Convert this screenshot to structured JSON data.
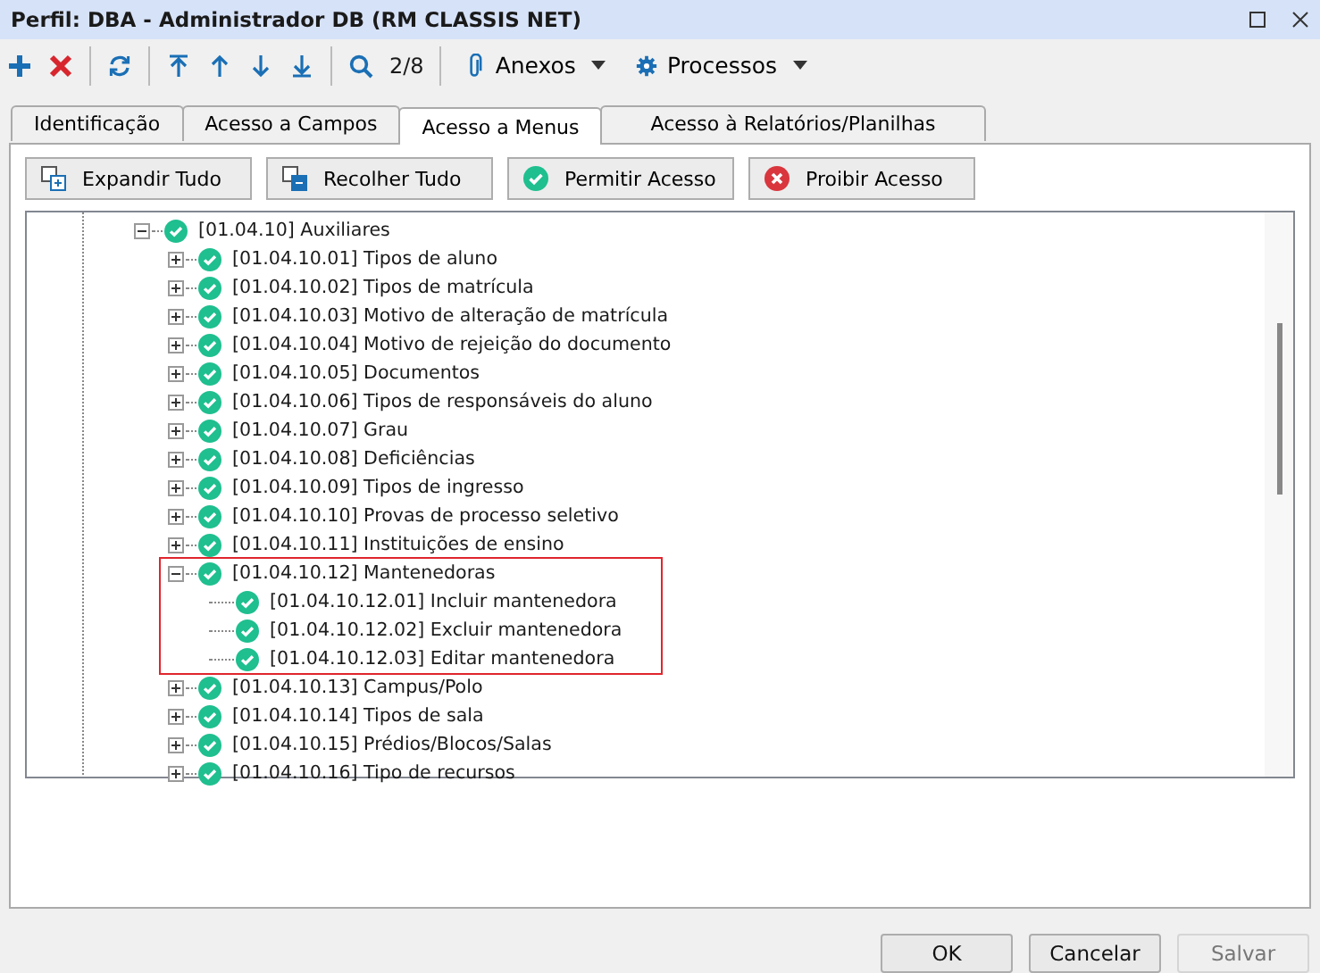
{
  "window": {
    "title": "Perfil: DBA - Administrador DB (RM CLASSIS NET)"
  },
  "toolbar": {
    "counter": "2/8",
    "menus": [
      {
        "label": "Anexos",
        "kind": "clip"
      },
      {
        "label": "Processos",
        "kind": "gear"
      }
    ]
  },
  "tabs": [
    {
      "label": "Identificação",
      "selected": false
    },
    {
      "label": "Acesso a Campos",
      "selected": false
    },
    {
      "label": "Acesso a Menus",
      "selected": true
    },
    {
      "label": "Acesso à Relatórios/Planilhas",
      "selected": false
    }
  ],
  "actions": [
    {
      "label": "Expandir Tudo",
      "kind": "expand"
    },
    {
      "label": "Recolher Tudo",
      "kind": "collapse"
    },
    {
      "label": "Permitir Acesso",
      "kind": "allow"
    },
    {
      "label": "Proibir Acesso",
      "kind": "deny"
    }
  ],
  "tree": [
    {
      "label": "[01.04.10] Auxiliares",
      "kind": "folder",
      "expanded": true,
      "allowed": true,
      "children": [
        {
          "label": "[01.04.10.01] Tipos de aluno",
          "kind": "folder",
          "expanded": false,
          "allowed": true
        },
        {
          "label": "[01.04.10.02] Tipos de matrícula",
          "kind": "folder",
          "expanded": false,
          "allowed": true
        },
        {
          "label": "[01.04.10.03] Motivo de alteração de matrícula",
          "kind": "folder",
          "expanded": false,
          "allowed": true
        },
        {
          "label": "[01.04.10.04] Motivo de rejeição do documento",
          "kind": "folder",
          "expanded": false,
          "allowed": true
        },
        {
          "label": "[01.04.10.05] Documentos",
          "kind": "folder",
          "expanded": false,
          "allowed": true
        },
        {
          "label": "[01.04.10.06] Tipos de responsáveis do aluno",
          "kind": "folder",
          "expanded": false,
          "allowed": true
        },
        {
          "label": "[01.04.10.07] Grau",
          "kind": "folder",
          "expanded": false,
          "allowed": true
        },
        {
          "label": "[01.04.10.08] Deficiências",
          "kind": "folder",
          "expanded": false,
          "allowed": true
        },
        {
          "label": "[01.04.10.09] Tipos de ingresso",
          "kind": "folder",
          "expanded": false,
          "allowed": true
        },
        {
          "label": "[01.04.10.10] Provas de processo seletivo",
          "kind": "folder",
          "expanded": false,
          "allowed": true
        },
        {
          "label": "[01.04.10.11] Instituições de ensino",
          "kind": "folder",
          "expanded": false,
          "allowed": true
        },
        {
          "label": "[01.04.10.12] Mantenedoras",
          "kind": "folder",
          "expanded": true,
          "allowed": true,
          "highlighted": true,
          "children": [
            {
              "label": "[01.04.10.12.01] Incluir mantenedora",
              "kind": "leaf",
              "allowed": true
            },
            {
              "label": "[01.04.10.12.02] Excluir mantenedora",
              "kind": "leaf",
              "allowed": true
            },
            {
              "label": "[01.04.10.12.03] Editar mantenedora",
              "kind": "leaf",
              "allowed": true
            }
          ]
        },
        {
          "label": "[01.04.10.13] Campus/Polo",
          "kind": "folder",
          "expanded": false,
          "allowed": true
        },
        {
          "label": "[01.04.10.14] Tipos de sala",
          "kind": "folder",
          "expanded": false,
          "allowed": true
        },
        {
          "label": "[01.04.10.15] Prédios/Blocos/Salas",
          "kind": "folder",
          "expanded": false,
          "allowed": true
        },
        {
          "label": "[01.04.10.16] Tipo de recursos",
          "kind": "folder",
          "expanded": false,
          "allowed": true
        }
      ]
    }
  ],
  "buttons": [
    {
      "label": "OK",
      "disabled": false
    },
    {
      "label": "Cancelar",
      "disabled": false
    },
    {
      "label": "Salvar",
      "disabled": true
    }
  ]
}
